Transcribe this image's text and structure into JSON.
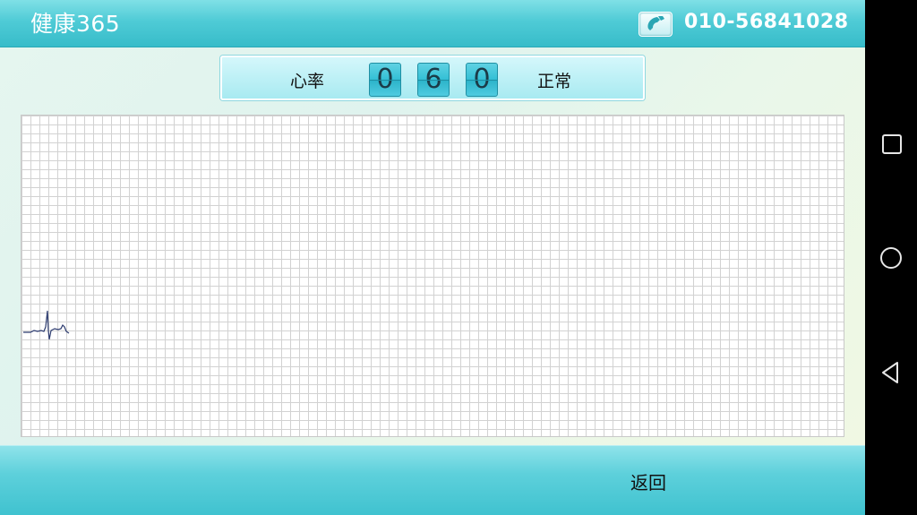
{
  "header": {
    "app_title": "健康365",
    "phone_number": "010-56841028",
    "phone_icon": "phone-icon"
  },
  "heart_rate": {
    "label": "心率",
    "digits": [
      "0",
      "6",
      "0"
    ],
    "status": "正常"
  },
  "footer": {
    "back_label": "返回"
  },
  "colors": {
    "header_accent": "#37bcc9",
    "ecg_trace": "#2b3a6e"
  },
  "navbar": {
    "icons": [
      "recent-apps-icon",
      "home-icon",
      "back-icon"
    ]
  }
}
